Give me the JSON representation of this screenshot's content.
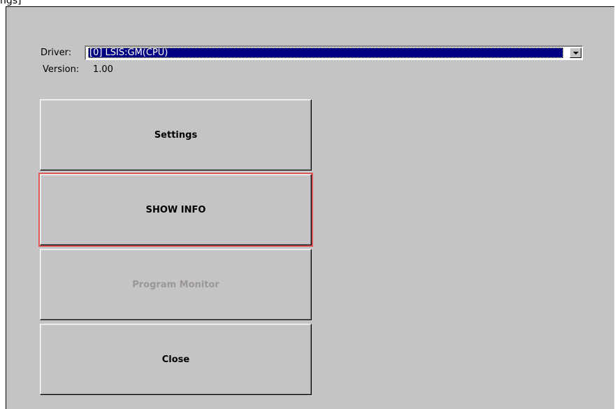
{
  "window": {
    "title_fragment": "ngs]"
  },
  "driver": {
    "label": "Driver:",
    "selected": "[0] LSIS:GM(CPU)"
  },
  "version": {
    "label": "Version:",
    "value": "1.00"
  },
  "buttons": {
    "settings": "Settings",
    "show_info": "SHOW INFO",
    "program_monitor": "Program Monitor",
    "close": "Close"
  },
  "colors": {
    "window_bg": "#c6c3c6",
    "selection_bg": "#000080",
    "focus_outline": "#e05858",
    "disabled_text": "#9a979a"
  }
}
